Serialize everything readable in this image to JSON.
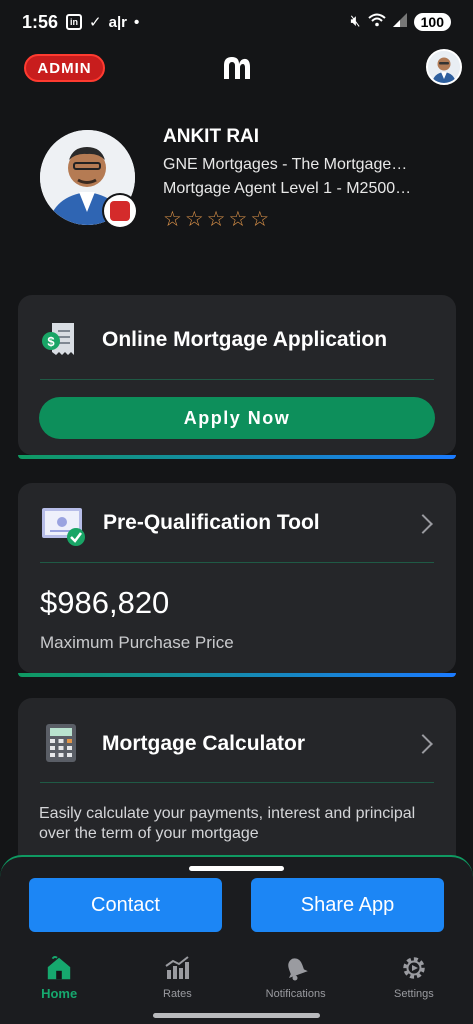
{
  "status_bar": {
    "time": "1:56",
    "left_icons": [
      "linkedin-icon",
      "check-icon",
      "air-icon"
    ],
    "battery": "100"
  },
  "header": {
    "admin_badge": "ADMIN",
    "logo_icon": "brand-logo-icon",
    "avatar_icon": "user-avatar"
  },
  "profile": {
    "name": "ANKIT RAI",
    "company": "GNE Mortgages - The Mortgage…",
    "role": "Mortgage Agent Level 1 - M2500…",
    "rating_stars": 0,
    "rating_max": 5,
    "star_glyph": "☆"
  },
  "cards": {
    "application": {
      "title": "Online Mortgage Application",
      "button": "Apply Now",
      "icon": "receipt-dollar-icon"
    },
    "prequal": {
      "title": "Pre-Qualification Tool",
      "amount": "$986,820",
      "amount_label": "Maximum Purchase Price",
      "icon": "certificate-check-icon"
    },
    "calculator": {
      "title": "Mortgage Calculator",
      "description": "Easily calculate your payments, interest and principal over the term of your mortgage",
      "icon": "calculator-icon"
    }
  },
  "actions": {
    "contact": "Contact",
    "share": "Share App"
  },
  "tabs": [
    {
      "label": "Home",
      "icon": "home-icon",
      "active": true
    },
    {
      "label": "Rates",
      "icon": "chart-bars-icon",
      "active": false
    },
    {
      "label": "Notifications",
      "icon": "bell-icon",
      "active": false
    },
    {
      "label": "Settings",
      "icon": "gear-icon",
      "active": false
    }
  ],
  "colors": {
    "accent_green": "#0d8f5b",
    "accent_blue": "#1c86f5",
    "admin_red": "#c81d1d",
    "star_orange": "#e0954a",
    "background": "#141517",
    "card": "#252629"
  }
}
